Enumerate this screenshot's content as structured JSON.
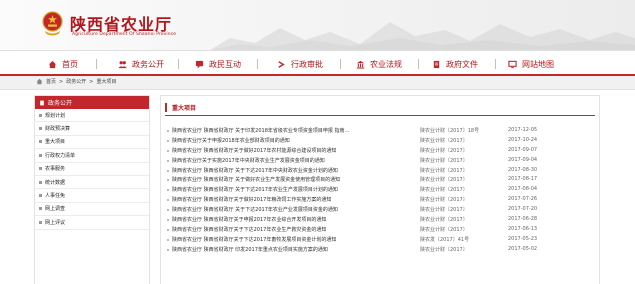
{
  "site": {
    "title": "陕西省农业厅",
    "subtitle": "Agriculture Department Of Shaanxi Province"
  },
  "nav": [
    {
      "label": "首页",
      "icon": "home-icon"
    },
    {
      "label": "政务公开",
      "icon": "people-icon"
    },
    {
      "label": "政民互动",
      "icon": "chat-icon"
    },
    {
      "label": "行政审批",
      "icon": "arrow-icon"
    },
    {
      "label": "农业法规",
      "icon": "building-icon"
    },
    {
      "label": "政府文件",
      "icon": "document-icon"
    },
    {
      "label": "网站地图",
      "icon": "monitor-icon"
    }
  ],
  "breadcrumb": {
    "home": "首页",
    "level1": "政务公开",
    "level2": "重大项目",
    "separator": ">"
  },
  "sidebar": {
    "title": "政务公开",
    "items": [
      "规划计划",
      "财政预决算",
      "重大项目",
      "行政权力清单",
      "农事服务",
      "统计数据",
      "人事任免",
      "网上调查",
      "网上评议"
    ]
  },
  "content": {
    "title": "重大项目",
    "rows": [
      {
        "title": "陕西省农业厅 陕西省财政厅 关于印发2018年省级农业专项资金项目申报 指南...",
        "doc": "陕农业计财〔2017〕18号",
        "date": "2017-12-05"
      },
      {
        "title": "陕西省农业厅关于申报2018年农业部财政项目的通知",
        "doc": "陕农业计财〔2017〕",
        "date": "2017-10-24"
      },
      {
        "title": "陕西省农业厅 陕西省财政厅关于做好2017年农村能源综合建设项目的通知",
        "doc": "陕农业计财〔2017〕",
        "date": "2017-09-07"
      },
      {
        "title": "陕西省农业厅关于实施2017年中央财政农业生产发展资金项目的通知",
        "doc": "陕农业计财〔2017〕",
        "date": "2017-09-04"
      },
      {
        "title": "陕西省农业厅 陕西省财政厅 关于下达2017年中央财政农业资金计划的通知",
        "doc": "陕农业计财〔2017〕",
        "date": "2017-08-30"
      },
      {
        "title": "陕西省农业厅 陕西省财政厅 关于做好农业生产发展资金使用管理项目的通知",
        "doc": "陕农业计财〔2017〕",
        "date": "2017-08-17"
      },
      {
        "title": "陕西省农业厅 陕西省财政厅 关于下达2017年农业生产发展项目计划的通知",
        "doc": "陕农业计财〔2017〕",
        "date": "2017-08-04"
      },
      {
        "title": "陕西省农业厅 陕西省财政厅关于做好2017年粮改饲工作实施方案的通知",
        "doc": "陕农业计财〔2017〕",
        "date": "2017-07-26"
      },
      {
        "title": "陕西省农业厅 陕西省财政厅 关于下达2017年农业产业发展项目资金的通知",
        "doc": "陕农业计财〔2017〕",
        "date": "2017-07-20"
      },
      {
        "title": "陕西省农业厅 陕西省财政厅关于申报2017年农业综合开发项目的通知",
        "doc": "陕农业计财〔2017〕",
        "date": "2017-06-28"
      },
      {
        "title": "陕西省农业厅 陕西省财政厅关于下达2017年农业生产救灾资金的通知",
        "doc": "陕农业计财〔2017〕",
        "date": "2017-06-13"
      },
      {
        "title": "陕西省农业厅 陕西省财政厅关于下达2017年畜牧发展项目资金计划的通知",
        "doc": "陕农发〔2017〕41号",
        "date": "2017-05-23"
      },
      {
        "title": "陕西省农业厅 陕西省财政厅 印发2017年重点农业项目实施方案的通知",
        "doc": "陕农业计财〔2017〕",
        "date": "2017-05-02"
      }
    ]
  },
  "colors": {
    "brand_red": "#c1272d",
    "title_red": "#b4161b"
  }
}
